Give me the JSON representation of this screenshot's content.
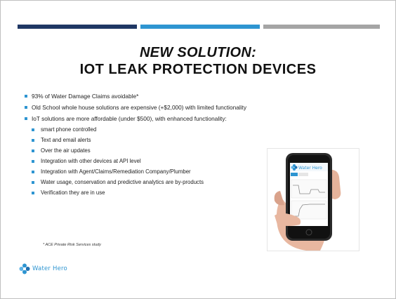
{
  "slide": {
    "title_line1": "NEW SOLUTION:",
    "title_line2": "IOT LEAK PROTECTION DEVICES",
    "bar_colors": [
      "#1f3764",
      "#2e95d1",
      "#a5a5a5"
    ]
  },
  "bullets": [
    {
      "text": "93% of Water Damage Claims avoidable*"
    },
    {
      "text": "Old School whole house solutions are expensive (+$2,000) with limited functionality"
    },
    {
      "text": "IoT solutions are more affordable (under $500),  with enhanced functionality:"
    }
  ],
  "sub_bullets": [
    "smart phone controlled",
    "Text and email alerts",
    "Over the air updates",
    "Integration with other devices at API level",
    "Integration with Agent/Claims/Remediation Company/Plumber",
    "Water usage, conservation and predictive analytics are by-products",
    "Verification they are in use"
  ],
  "footnote": "*  ACE Private Risk Services study",
  "logo": {
    "text": "Water Hero",
    "icon": "water-hero-cross-logo"
  },
  "phone_screen": {
    "app_name": "Water Hero"
  },
  "accent_color": "#2e95d1"
}
